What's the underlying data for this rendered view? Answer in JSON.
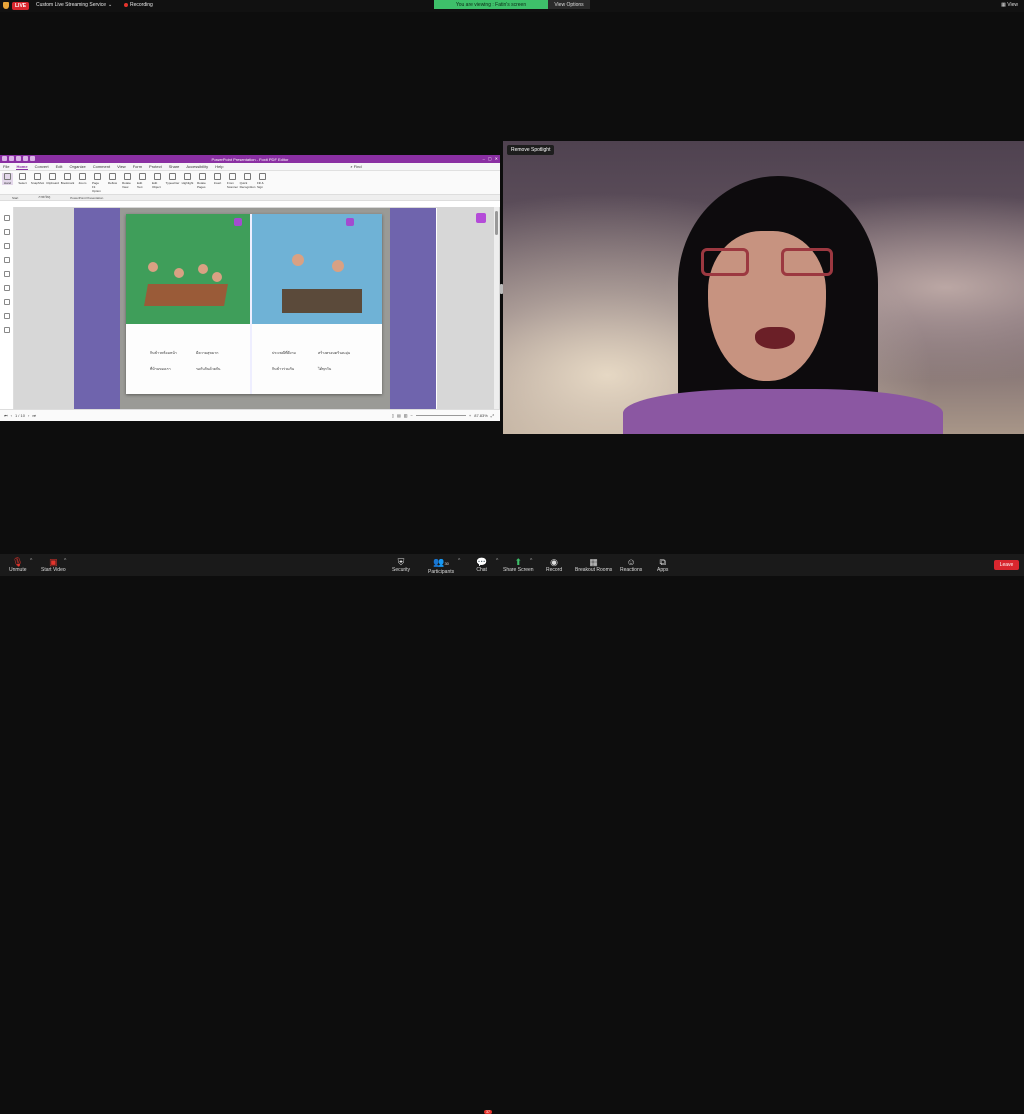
{
  "topbar": {
    "live": "LIVE",
    "streaming": "Custom Live Streaming Service",
    "recording": "Recording",
    "viewing": "You are viewing : Fatin's screen",
    "view_options": "View Options",
    "view": "View"
  },
  "app": {
    "title": "PowerPoint Presentation - Foxit PDF Editor",
    "menu": [
      "File",
      "Home",
      "Convert",
      "Edit",
      "Organize",
      "Comment",
      "View",
      "Form",
      "Protect",
      "Share",
      "Accessibility",
      "Help"
    ],
    "active_menu": "Home",
    "search_placeholder": "Find",
    "ribbon": [
      "Hand",
      "Select",
      "SnapShot",
      "Clipboard",
      "Bookmark",
      "Zoom",
      "Page Fit Option",
      "Reflow",
      "Rotate View",
      "Edit Text",
      "Edit Object",
      "Typewriter",
      "Highlight",
      "Rotate Pages",
      "Insert",
      "From Scanner",
      "Quick Recognition",
      "Fill & Sign"
    ],
    "tabs": [
      "Start",
      "ภาพ/วัตถุ",
      "PowerPoint Presentation"
    ],
    "page_indicator": "1 / 10",
    "zoom": "87.83%",
    "thai_lines": [
      "กินข้าวพร้อมหน้า",
      "ที่บ้านของเรา",
      "มีความสุขมาก",
      "รอกันกินด้วยกัน",
      "ประเพณีที่ดีงาม",
      "กินข้าวร่วมกัน",
      "สร้างครอบครัวอบอุ่น",
      "ได้ทุกวัน"
    ]
  },
  "video": {
    "remove_spotlight": "Remove Spotlight"
  },
  "toolbar": {
    "unmute": "Unmute",
    "start_video": "Start Video",
    "security": "Security",
    "participants": "Participants",
    "participants_count": "30",
    "chat": "Chat",
    "chat_badge": "37",
    "share_screen": "Share Screen",
    "record": "Record",
    "breakout": "Breakout Rooms",
    "reactions": "Reactions",
    "apps": "Apps",
    "leave": "Leave"
  }
}
